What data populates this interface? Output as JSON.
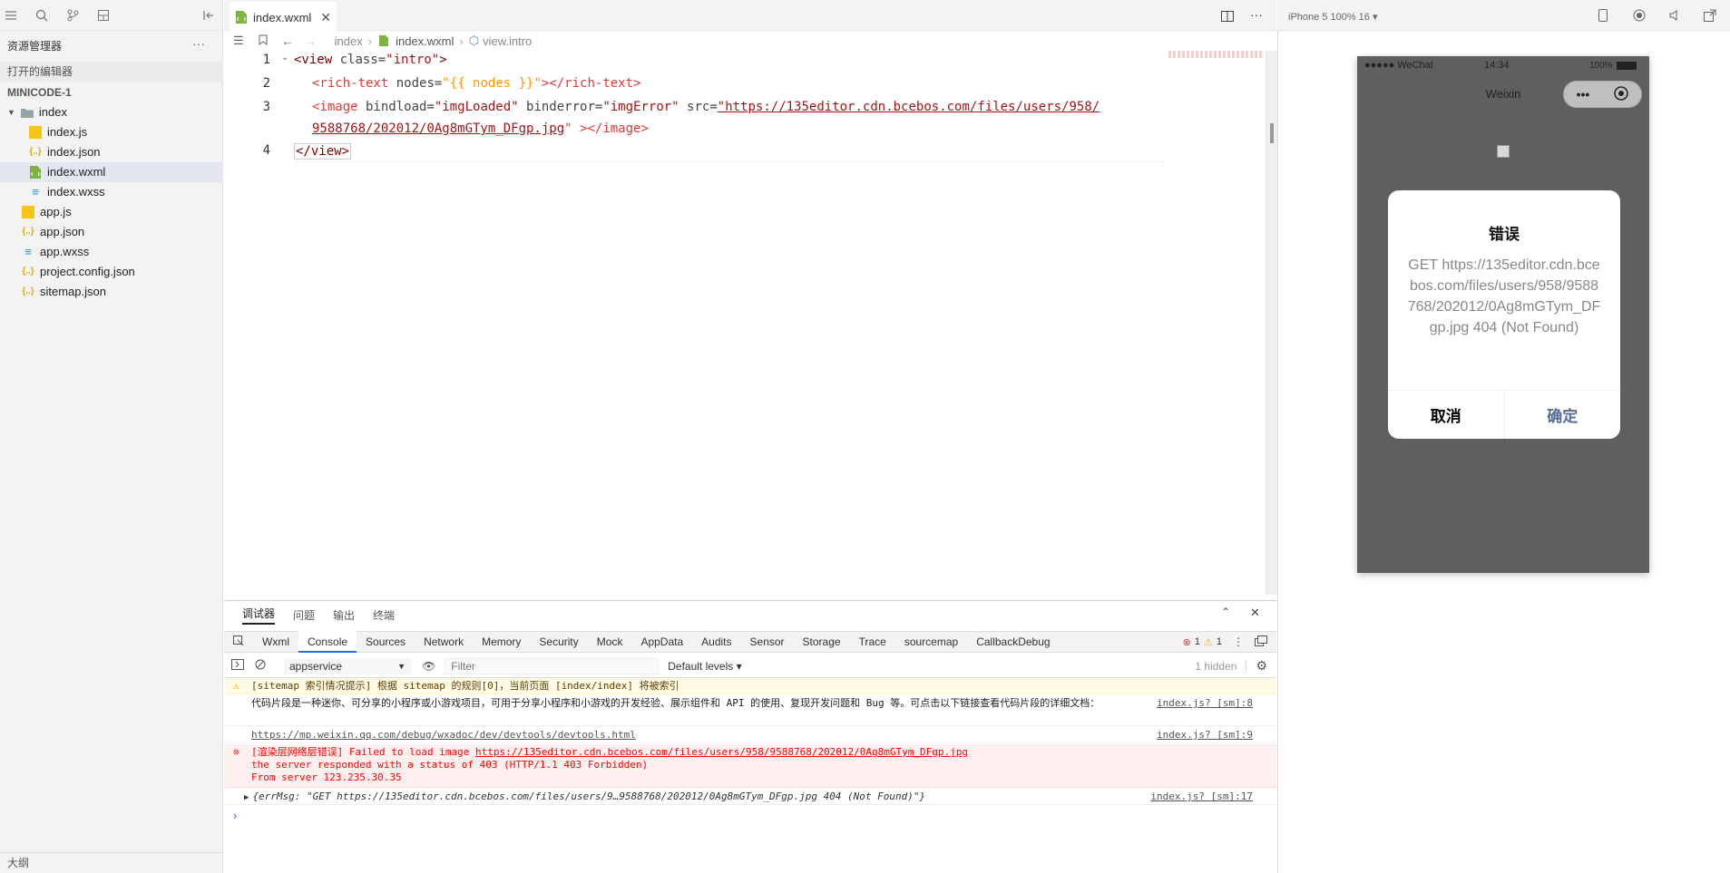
{
  "sidebar": {
    "title": "资源管理器",
    "more": "···",
    "open_editors": "打开的编辑器",
    "project": "MINICODE-1",
    "tree": [
      {
        "label": "index",
        "icon": "folder-icon",
        "indent": 0
      },
      {
        "label": "index.js",
        "icon": "js-file-icon",
        "indent": 1
      },
      {
        "label": "index.json",
        "icon": "json-file-icon",
        "indent": 1
      },
      {
        "label": "index.wxml",
        "icon": "wxml-file-icon",
        "indent": 1,
        "selected": true
      },
      {
        "label": "index.wxss",
        "icon": "wxss-file-icon",
        "indent": 1
      },
      {
        "label": "app.js",
        "icon": "js-file-icon",
        "indent": 0
      },
      {
        "label": "app.json",
        "icon": "json-file-icon",
        "indent": 0
      },
      {
        "label": "app.wxss",
        "icon": "wxss-file-icon",
        "indent": 0
      },
      {
        "label": "project.config.json",
        "icon": "json-file-icon",
        "indent": 0
      },
      {
        "label": "sitemap.json",
        "icon": "json-file-icon",
        "indent": 0
      }
    ],
    "outline": "大纲"
  },
  "editor": {
    "tab": "index.wxml",
    "breadcrumb": [
      "index",
      "index.wxml",
      "view.intro"
    ],
    "line_numbers": [
      "1",
      "2",
      "3",
      "4"
    ],
    "code": {
      "l1_open": "<view",
      "l1_attr": " class=",
      "l1_val": "\"intro\"",
      "l1_close": ">",
      "l2_open": "<rich-text",
      "l2_attr": " nodes=",
      "l2_val": "\"{{ nodes }}\"",
      "l2_close": "></rich-text>",
      "l3_open": "<image",
      "l3_attr1": " bindload=",
      "l3_val1": "\"imgLoaded\"",
      "l3_attr2": " binderror=",
      "l3_val2": "\"imgError\"",
      "l3_attr3": " src=",
      "l3_url1": "\"https://135editor.cdn.bcebos.com/files/users/958/",
      "l3_url2": "9588768/202012/0Ag8mGTym_DFgp.jpg",
      "l3_end": "\" ></image>",
      "l4": "</view>"
    }
  },
  "panel": {
    "tabs": [
      "调试器",
      "问题",
      "输出",
      "终端"
    ],
    "devtools_tabs": [
      "Wxml",
      "Console",
      "Sources",
      "Network",
      "Memory",
      "Security",
      "Mock",
      "AppData",
      "Audits",
      "Sensor",
      "Storage",
      "Trace",
      "sourcemap",
      "CallbackDebug"
    ],
    "active_devtools_tab": "Console",
    "error_count": "1",
    "warning_count": "1",
    "context": "appservice",
    "filter_placeholder": "Filter",
    "levels": "Default levels",
    "hidden": "1 hidden",
    "console": {
      "warn": "[sitemap 索引情况提示] 根据 sitemap 的规则[0]，当前页面 [index/index] 将被索引",
      "info1": "代码片段是一种迷你、可分享的小程序或小游戏项目，可用于分享小程序和小游戏的开发经验、展示组件和 API 的使用、复现开发问题和 Bug 等。可点击以下链接查看代码片段的详细文档：",
      "info1_src": "index.js? [sm]:8",
      "info2": "https://mp.weixin.qq.com/debug/wxadoc/dev/devtools/devtools.html",
      "info2_src": "index.js? [sm]:9",
      "err_prefix": "[渲染层网络层错误]",
      "err_text": " Failed to load image ",
      "err_url": "https://135editor.cdn.bcebos.com/files/users/958/9588768/202012/0Ag8mGTym_DFgp.jpg",
      "err_line2": "the server responded with a status of 403 (HTTP/1.1 403 Forbidden)",
      "err_line3": "From server 123.235.30.35",
      "obj": "{errMsg: \"GET https://135editor.cdn.bcebos.com/files/users/9…9588768/202012/0Ag8mGTym_DFgp.jpg 404 (Not Found)\"}",
      "obj_src": "index.js? [sm]:17"
    }
  },
  "simulator": {
    "device": "iPhone 5 100% 16 ▾",
    "signal": "●●●●● WeChat",
    "time": "14:34",
    "battery": "100%",
    "nav_title": "Weixin",
    "modal": {
      "title": "错误",
      "body": "GET https://135editor.cdn.bcebos.com/files/users/958/9588768/202012/0Ag8mGTym_DFgp.jpg 404 (Not Found)",
      "cancel": "取消",
      "confirm": "确定"
    }
  },
  "colors": {
    "accent": "#576b95",
    "error": "#ff0000",
    "warn_bg": "#fffbe5",
    "err_bg": "#fff0f0"
  }
}
